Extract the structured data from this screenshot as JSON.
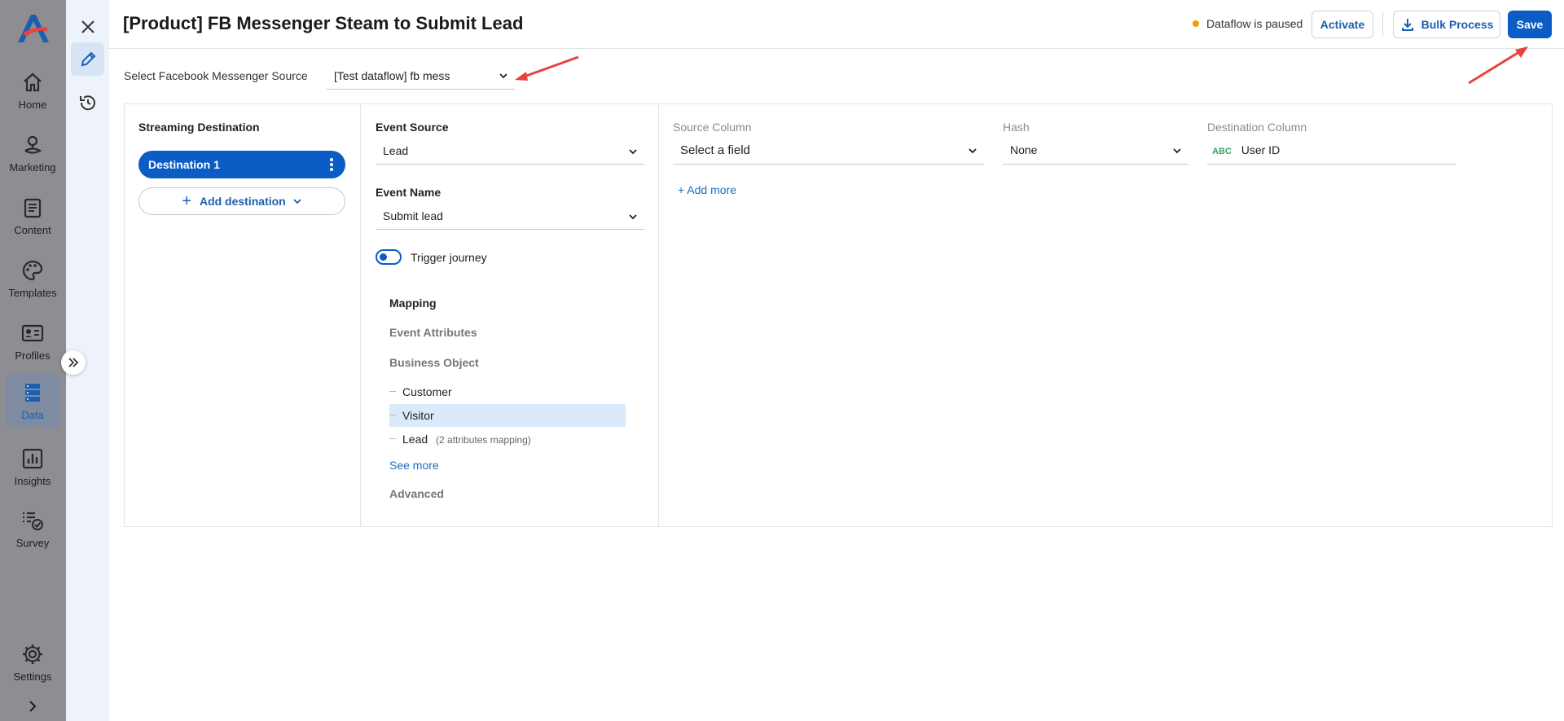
{
  "nav": {
    "items": [
      {
        "label": "Home",
        "icon": "home-icon"
      },
      {
        "label": "Marketing",
        "icon": "marketing-icon"
      },
      {
        "label": "Content",
        "icon": "content-icon"
      },
      {
        "label": "Templates",
        "icon": "palette-icon"
      },
      {
        "label": "Profiles",
        "icon": "profile-card-icon"
      },
      {
        "label": "Data",
        "icon": "database-icon",
        "active": true
      },
      {
        "label": "Insights",
        "icon": "chart-icon"
      },
      {
        "label": "Survey",
        "icon": "survey-icon"
      },
      {
        "label": "Settings",
        "icon": "gear-icon"
      }
    ]
  },
  "header": {
    "title": "[Product] FB Messenger Steam to Submit Lead",
    "status": "Dataflow is paused",
    "activate": "Activate",
    "bulk_process": "Bulk Process",
    "save": "Save"
  },
  "source": {
    "label": "Select Facebook Messenger Source",
    "value": "[Test dataflow] fb mess"
  },
  "streaming": {
    "title": "Streaming Destination",
    "destination": "Destination 1",
    "add_destination": "Add destination"
  },
  "event": {
    "source_label": "Event Source",
    "source_value": "Lead",
    "name_label": "Event Name",
    "name_value": "Submit lead",
    "trigger_label": "Trigger journey"
  },
  "mapping": {
    "title": "Mapping",
    "event_attributes": "Event Attributes",
    "business_object": "Business Object",
    "objects": [
      {
        "label": "Customer",
        "note": ""
      },
      {
        "label": "Visitor",
        "note": ""
      },
      {
        "label": "Lead",
        "note": "(2 attributes mapping)"
      }
    ],
    "see_more": "See more",
    "advanced": "Advanced"
  },
  "columns": {
    "source_head": "Source Column",
    "hash_head": "Hash",
    "dest_head": "Destination Column",
    "source_value": "Select a field",
    "hash_value": "None",
    "dest_type": "ABC",
    "dest_value": "User ID",
    "add_more": "+ Add more"
  },
  "colors": {
    "primary": "#0b5cc5",
    "status_dot": "#f0a000",
    "nav_bg": "#8e8e92",
    "selected_row": "#d9eafa",
    "annotation_arrow": "#e8423f"
  }
}
